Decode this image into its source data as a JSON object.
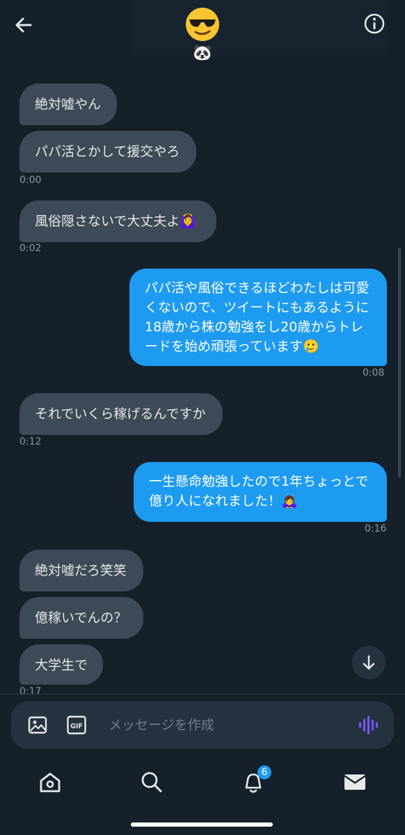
{
  "header": {
    "avatar_emoji": "😎",
    "sub_emoji": "🐼"
  },
  "messages": [
    {
      "direction": "in",
      "text": "絶対嘘やん"
    },
    {
      "direction": "in",
      "text": "パパ活とかして援交やろ",
      "time": "0:00"
    },
    {
      "direction": "in",
      "text": "風俗隠さないで大丈夫よ🙆‍♀️",
      "time": "0:02"
    },
    {
      "direction": "out",
      "text": "パパ活や風俗できるほどわたしは可愛くないので、ツイートにもあるように18歳から株の勉強をし20歳からトレードを始め頑張っています🥲",
      "time": "0:08"
    },
    {
      "direction": "in",
      "text": "それでいくら稼げるんですか",
      "time": "0:12"
    },
    {
      "direction": "out",
      "text": "一生懸命勉強したので1年ちょっとで億り人になれました！🙇‍♀️",
      "time": "0:16"
    },
    {
      "direction": "in",
      "text": "絶対嘘だろ笑笑"
    },
    {
      "direction": "in",
      "text": "億稼いでんの？"
    },
    {
      "direction": "in",
      "text": "大学生で",
      "time": "0:17"
    }
  ],
  "composer": {
    "placeholder": "メッセージを作成",
    "gif_label": "GIF"
  },
  "nav": {
    "notifications_badge": "6"
  },
  "colors": {
    "background": "#15202b",
    "incoming_bubble": "#3d4a57",
    "outgoing_bubble": "#1d9bf0",
    "accent_voice": "#7856ff"
  }
}
